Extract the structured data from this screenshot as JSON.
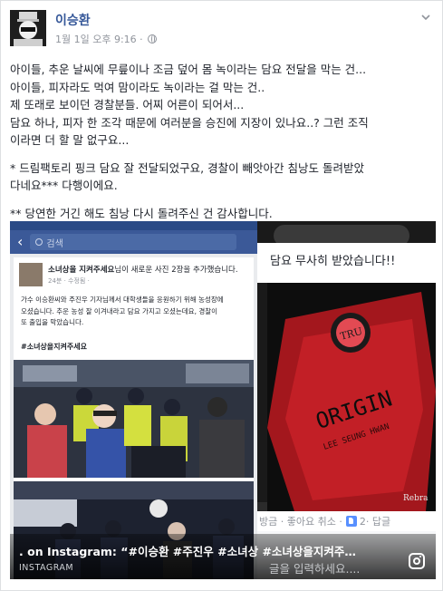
{
  "post": {
    "author": "이승환",
    "timestamp": "1월 1일 오후 9:16 ·",
    "privacy_icon": "globe-icon",
    "menu_icon": "chevron-down-icon",
    "lines": [
      "아이들, 추운 날씨에 무릎이나 조금 덮어 몸 녹이라는 담요 전달을 막는 건...",
      "아이들, 피자라도 먹여 맘이라도 녹이라는 걸 막는 건..",
      "제 또래로 보이던 경찰분들. 어찌 어른이 되어서...",
      "담요 하나, 피자 한 조각 때문에 여러분을 승진에 지장이 있나요..? 그런 조직",
      "이라면 더 할 말 없구요...",
      "* 드림팩토리 핑크 담요 잘 전달되었구요, 경찰이 빼앗아간 침낭도 돌려받았",
      "다네요*** 다행이에요.",
      "** 당연한 거긴 해도 침낭 다시 돌려주신 건 감사합니다."
    ]
  },
  "media": {
    "phone": {
      "search_placeholder": "검색",
      "page_name": "소녀상을 지켜주세요",
      "page_action": "님이 새로운 사진 2장을 추가했습니다.",
      "page_time": "24분 · 수정됨 ·",
      "page_text": [
        "가수 이승환씨와 주진우 기자님께서 대학생들을 응원하기 위해 농성장에",
        "오셨습니다. 추운 농성 잘 이겨내라고 담요 가지고 오셨는데요, 경찰이",
        "또 출입을 막았습니다."
      ],
      "page_hashtag": "#소녀상을지켜주세요"
    },
    "message_text": "담요 무사히 받았습니다!!",
    "reactions": {
      "text": "방금 · 좋아요 취소 · ",
      "like_icon": "thumbs-up-icon",
      "count": "2",
      "reply": " · 답글"
    },
    "caption_title": ". on Instagram: “#이승환 #주진우 #소녀상 #소녀상을지켜주…",
    "caption_source": "INSTAGRAM",
    "comment_placeholder": "글을 입력하세요....",
    "instagram_icon": "instagram-icon"
  },
  "colors": {
    "link_blue": "#365899",
    "fb_blue": "#3b5998",
    "meta_grey": "#90949c"
  }
}
